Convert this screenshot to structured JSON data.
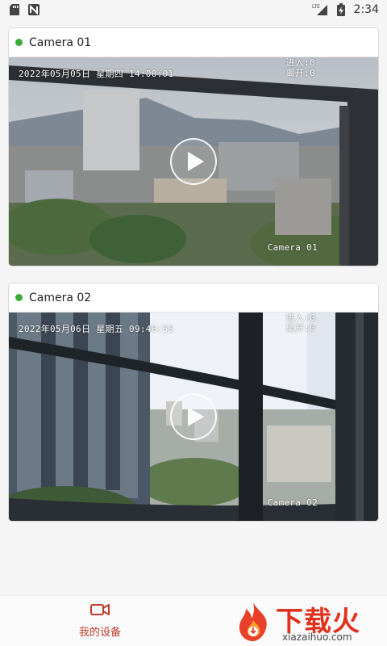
{
  "status_bar": {
    "time": "2:34",
    "network": "LTE"
  },
  "cameras": [
    {
      "title": "Camera 01",
      "status_color": "#3aaa3a",
      "timestamp": "2022年05月05日 星期四 14:00:01",
      "enter": "进入:0",
      "leave": "离开:0",
      "overlay_name": "Camera 01"
    },
    {
      "title": "Camera 02",
      "status_color": "#3aaa3a",
      "timestamp": "2022年05月06日 星期五 09:46:55",
      "enter": "进入:0",
      "leave": "离开:0",
      "overlay_name": "Camera 02"
    }
  ],
  "bottom_nav": {
    "items": [
      {
        "label": "我的设备",
        "icon": "video-camera-icon",
        "active": true,
        "color": "#c23a2a"
      }
    ]
  },
  "watermark": {
    "brand": "下载火",
    "url": "xiazaihuo.com"
  }
}
